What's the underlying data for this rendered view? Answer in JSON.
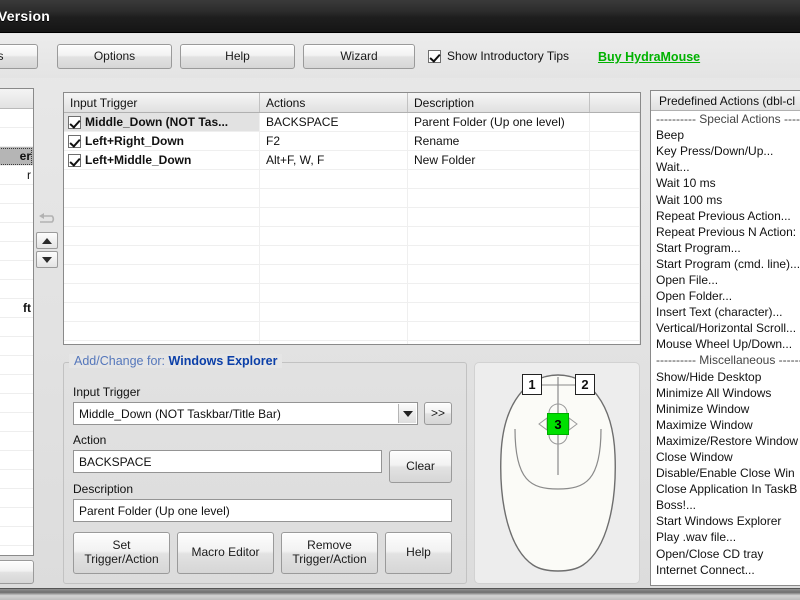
{
  "titlebar": {
    "text": "Version"
  },
  "toolbar": {
    "partial_button": "s",
    "options_button": "Options",
    "help_button": "Help",
    "wizard_button": "Wizard",
    "show_tips_label": "Show Introductory Tips",
    "show_tips_checked": "true",
    "buy_link": "Buy HydraMouse",
    "buy_link_color": "#00b200"
  },
  "app_list": {
    "rows": [
      {
        "text": ""
      },
      {
        "text": ""
      },
      {
        "text": "er",
        "selected": "true"
      },
      {
        "text": "r"
      },
      {
        "text": ""
      },
      {
        "text": ""
      },
      {
        "text": ""
      },
      {
        "text": ""
      },
      {
        "text": ""
      },
      {
        "text": ""
      },
      {
        "text": "ft",
        "bold": "true"
      },
      {
        "text": ""
      },
      {
        "text": ""
      },
      {
        "text": ""
      },
      {
        "text": ""
      },
      {
        "text": ""
      },
      {
        "text": ""
      },
      {
        "text": ""
      },
      {
        "text": ""
      },
      {
        "text": ""
      },
      {
        "text": ""
      },
      {
        "text": ""
      },
      {
        "text": ""
      }
    ]
  },
  "trigger_table": {
    "columns": [
      "Input Trigger",
      "Actions",
      "Description",
      ""
    ],
    "rows": [
      {
        "checked": "true",
        "trigger": "Middle_Down (NOT Tas...",
        "action": "BACKSPACE",
        "description": "Parent Folder (Up one level)",
        "selected": "true"
      },
      {
        "checked": "true",
        "trigger": "Left+Right_Down",
        "action": "F2",
        "description": "Rename",
        "selected": "false"
      },
      {
        "checked": "true",
        "trigger": "Left+Middle_Down",
        "action": "Alt+F, W, F",
        "description": "New Folder",
        "selected": "false"
      }
    ]
  },
  "predefined_actions": {
    "header": "Predefined Actions (dbl-cl",
    "items": [
      "---------- Special Actions ----",
      "Beep",
      "Key Press/Down/Up...",
      "Wait...",
      "Wait 10 ms",
      "Wait 100 ms",
      "Repeat Previous Action...",
      "Repeat Previous N Action:",
      "Start Program...",
      "Start Program (cmd. line)...",
      "Open File...",
      "Open Folder...",
      "Insert Text (character)...",
      "Vertical/Horizontal Scroll...",
      "Mouse Wheel Up/Down...",
      "---------- Miscellaneous ------",
      "Show/Hide Desktop",
      "Minimize All Windows",
      "Minimize Window",
      "Maximize Window",
      "Maximize/Restore Window",
      "Close Window",
      "Disable/Enable Close Win",
      "Close Application In TaskB",
      "Boss!...",
      "Start Windows Explorer",
      "Play .wav file...",
      "Open/Close CD tray",
      "Internet Connect..."
    ]
  },
  "add_change": {
    "title_prefix": "Add/Change for:",
    "title_target": "Windows Explorer",
    "input_trigger_label": "Input Trigger",
    "input_trigger_value": "Middle_Down (NOT Taskbar/Title Bar)",
    "expand_button": ">>",
    "action_label": "Action",
    "action_value": "BACKSPACE",
    "clear_button": "Clear",
    "description_label": "Description",
    "description_value": "Parent Folder (Up one level)",
    "set_button_line1": "Set",
    "set_button_line2": "Trigger/Action",
    "macro_button": "Macro Editor",
    "remove_button_line1": "Remove",
    "remove_button_line2": "Trigger/Action",
    "help_button": "Help"
  },
  "mouse_diagram": {
    "button1_label": "1",
    "button2_label": "2",
    "wheel_label": "3",
    "wheel_highlight_color": "#00e000"
  }
}
